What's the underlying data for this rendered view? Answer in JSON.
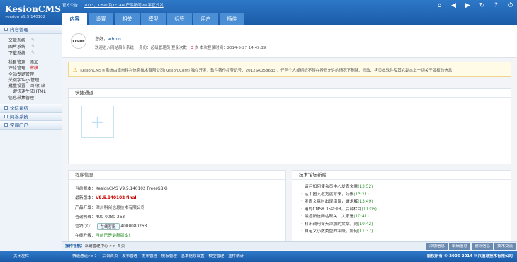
{
  "header": {
    "logo": "KesionCMS",
    "version": "version V9.5.140102",
    "notice_label": "官方公告：",
    "notice_link": "2013，Tmall及TFTAN 产品新闻V9 平正式发",
    "tabs": [
      "内容",
      "设置",
      "相关",
      "模型",
      "标签",
      "用户",
      "插件"
    ],
    "icons": [
      "home-icon",
      "back-icon",
      "forward-icon",
      "refresh-icon",
      "help-icon",
      "power-icon"
    ]
  },
  "sidebar": {
    "section1": "内容管理",
    "sub": [
      {
        "label": "文章系统"
      },
      {
        "label": "图片系统"
      },
      {
        "label": "下载系统"
      }
    ],
    "links": [
      {
        "a": "栏目管理",
        "b": "添加"
      },
      {
        "a": "评论管理",
        "b": "审核"
      },
      {
        "a": "全站专题管理",
        "b": ""
      },
      {
        "a": "关键字Tags管理",
        "b": ""
      },
      {
        "a": "批量设置",
        "b": "回 收 站"
      },
      {
        "a": "一键快速生成HTML",
        "b": ""
      },
      {
        "a": "信息采集管理",
        "b": ""
      }
    ],
    "section2": "论坛系统",
    "section3": "问答系统",
    "section4": "空间门户"
  },
  "welcome": {
    "avatar_text": "KESION",
    "hello": "您好，",
    "user": "admin",
    "line_prefix": "欢迎进入网站后台系统！ 身份：",
    "role": "超级管理员",
    "login_text": " 登录次数：",
    "login_count": "3",
    "last_login": " 次 本次登录时间：2014-5-27 14:45:19"
  },
  "warning": "KesionCMS®系统由漳州科兴信息技术有限公司(Kesion.Com) 独立开发，软件著作权登记号：2012SR058633 ，任何个人或组织不得在授权允许的情况下删除、修改、拷贝本软件及其它副本上一切关于版权的信息",
  "quick": {
    "title": "快捷通道"
  },
  "program": {
    "title": "程序信息",
    "current_label": "当前版本：",
    "current": "KesionCMS V9.5.140102 Free(GBK)",
    "latest_label": "最新版本：",
    "latest": "V9.5.140102 final",
    "dev_label": "产品开发：",
    "dev": "漳州科兴信息技术有限公司",
    "tel_label": "咨询热线：",
    "tel": "400-0080-263",
    "qq_label": "营销QQ：",
    "qq_btn": "在线客服",
    "qq": "4000080263",
    "upgrade_label": "在线升级：",
    "upgrade": "当前已是最新版本!"
  },
  "forum": {
    "title": "技术论坛新贴",
    "items": [
      {
        "text": "请问如何使会员中心发表文章",
        "time": "(13:52)"
      },
      {
        "text": "这个图文框宽度写来，勿删",
        "time": "(13:21)"
      },
      {
        "text": "发表文章时出现错误，请求解",
        "time": "(13:49)"
      },
      {
        "text": "用的CMS8.05sf卡8，后台栏目",
        "time": "(11:06)"
      },
      {
        "text": "最近新信网站取关：大家是",
        "time": "(10:41)"
      },
      {
        "text": "科讯调用令天添加的文章，则",
        "time": "(10:42)"
      },
      {
        "text": "自定义小数类型的字段，加何",
        "time": "(11:37)"
      }
    ]
  },
  "crumb": {
    "label": "操作导航：",
    "path": "系统管理中心 >> 首页",
    "buttons": [
      "添加信息",
      "编辑信息",
      "删除信息",
      "技术交流"
    ]
  },
  "footer": {
    "close": "关闭左栏",
    "links": [
      "快速通道>>：",
      "后台首页",
      "发布管理",
      "发布管理",
      "模板管理",
      "基本信息设置",
      "模型管理",
      "插件统计"
    ],
    "copyright": "版权所有 © 2006-2014 科兴信息技术有限公司"
  }
}
